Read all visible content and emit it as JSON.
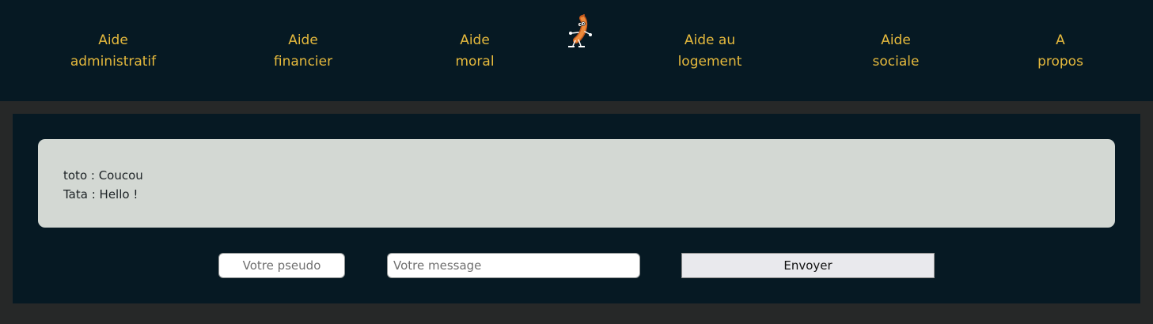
{
  "nav": {
    "items": [
      {
        "line1": "Aide",
        "line2": "administratif"
      },
      {
        "line1": "Aide",
        "line2": "financier"
      },
      {
        "line1": "Aide",
        "line2": "moral"
      },
      {
        "line1": "Aide au",
        "line2": "logement"
      },
      {
        "line1": "Aide",
        "line2": "sociale"
      },
      {
        "line1": "A",
        "line2": "propos"
      }
    ],
    "logo_icon": "sausage-mascot-icon"
  },
  "chat": {
    "messages": [
      {
        "text": "toto : Coucou"
      },
      {
        "text": "Tata : Hello !"
      }
    ]
  },
  "form": {
    "pseudo_placeholder": "Votre pseudo",
    "pseudo_value": "",
    "message_placeholder": "Votre message",
    "message_value": "",
    "send_label": "Envoyer"
  },
  "colors": {
    "nav_background": "#061923",
    "nav_text": "#e5b93d",
    "page_background": "#262828",
    "chat_box": "#d3d8d3"
  }
}
